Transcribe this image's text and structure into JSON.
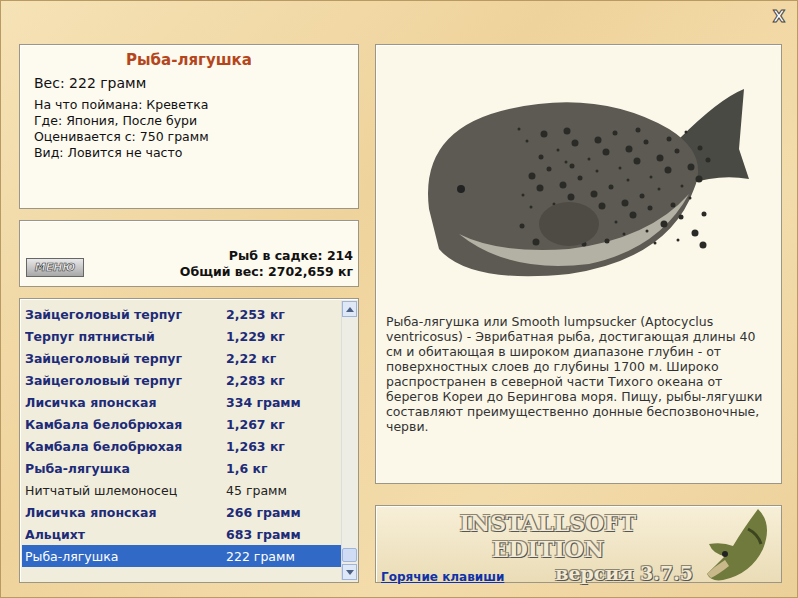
{
  "window": {
    "close": "X"
  },
  "fish_info": {
    "title": "Рыба-лягушка",
    "weight": "Вес: 222 грамм",
    "details": [
      "На что поймана: Креветка",
      "Где: Япония, После бури",
      "Оценивается с: 750 грамм",
      "Вид: Ловится не часто"
    ]
  },
  "summary": {
    "menu_button": "МЕНЮ",
    "count": "Рыб в садке: 214",
    "total": "Общий вес: 2702,659 кг"
  },
  "catch_list": {
    "scroll": {
      "level": 1
    },
    "rows": [
      {
        "name": "Зайцеголовый терпуг",
        "weight": "2,253 кг",
        "bold": true,
        "selected": false
      },
      {
        "name": "Терпуг пятнистый",
        "weight": "1,229 кг",
        "bold": true,
        "selected": false
      },
      {
        "name": "Зайцеголовый терпуг",
        "weight": "2,22 кг",
        "bold": true,
        "selected": false
      },
      {
        "name": "Зайцеголовый терпуг",
        "weight": "2,283 кг",
        "bold": true,
        "selected": false
      },
      {
        "name": "Лисичка японская",
        "weight": "334 грамм",
        "bold": true,
        "selected": false
      },
      {
        "name": "Камбала белобрюхая",
        "weight": "1,267 кг",
        "bold": true,
        "selected": false
      },
      {
        "name": "Камбала белобрюхая",
        "weight": "1,263 кг",
        "bold": true,
        "selected": false
      },
      {
        "name": "Рыба-лягушка",
        "weight": "1,6 кг",
        "bold": true,
        "selected": false
      },
      {
        "name": "Нитчатый шлемоносец",
        "weight": "45 грамм",
        "bold": false,
        "selected": false
      },
      {
        "name": "Лисичка японская",
        "weight": "266 грамм",
        "bold": true,
        "selected": false
      },
      {
        "name": "Альцихт",
        "weight": "683 грамм",
        "bold": true,
        "selected": false
      },
      {
        "name": "Рыба-лягушка",
        "weight": "222 грамм",
        "bold": false,
        "selected": true
      }
    ]
  },
  "description": "Рыба-лягушка или Smooth lumpsucker (Aptocyclus ventricosus) - Эврибатная рыба, достигающая длины 40 см и обитающая в широком диапазоне глубин - от поверхностных слоев до глубины 1700 м. Широко распространен в северной части Тихого океана от берегов Кореи до Берингова моря. Пищу, рыбы-лягушки составляют преимущественно донные беспозвоночные, черви.",
  "footer": {
    "brand": "INSTALLSOFT EDITION",
    "version": "версия 3.7.5",
    "hotkeys_link": "Горячие клавиши"
  }
}
